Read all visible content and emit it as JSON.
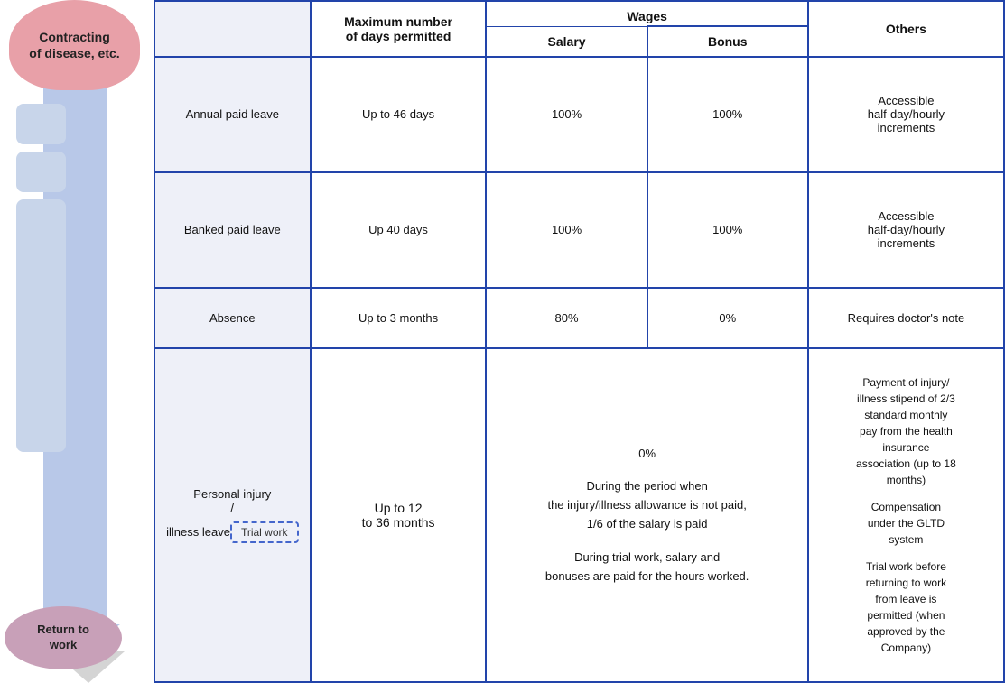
{
  "left": {
    "top_label": "Contracting\nof disease, etc.",
    "return_label": "Return to\nwork"
  },
  "table": {
    "headers": {
      "max_days": "Maximum number\nof days permitted",
      "wages": "Wages",
      "salary": "Salary",
      "bonus": "Bonus",
      "others": "Others"
    },
    "rows": [
      {
        "label": "Annual paid leave",
        "max_days": "Up to 46 days",
        "salary": "100%",
        "bonus": "100%",
        "others": "Accessible\nhalf-day/hourly\nincrements"
      },
      {
        "label": "Banked paid leave",
        "max_days": "Up 40 days",
        "salary": "100%",
        "bonus": "100%",
        "others": "Accessible\nhalf-day/hourly\nincrements"
      },
      {
        "label": "Absence",
        "max_days": "Up to 3 months",
        "salary": "80%",
        "bonus": "0%",
        "others": "Requires doctor's note"
      },
      {
        "label": "Personal injury\n/\nillness leave",
        "trial_work": "Trial work",
        "max_days": "Up to 12\nto 36 months",
        "salary_combined": "0%\n\nDuring the period when\nthe injury/illness allowance is not paid,\n1/6 of the salary is paid\n\nDuring trial work, salary and\nbonuses are paid for the hours worked.",
        "others": "Payment of injury/\nillness stipend of 2/3\nstandard monthly\npay from the health\ninsurance\nassociation (up to 18\nmonths)\n\nCompensation\nunder the GLTD\nsystem\n\nTrial work before\nreturning to work\nfrom leave is\npermitted (when\napproved by the\nCompany)"
      }
    ]
  }
}
